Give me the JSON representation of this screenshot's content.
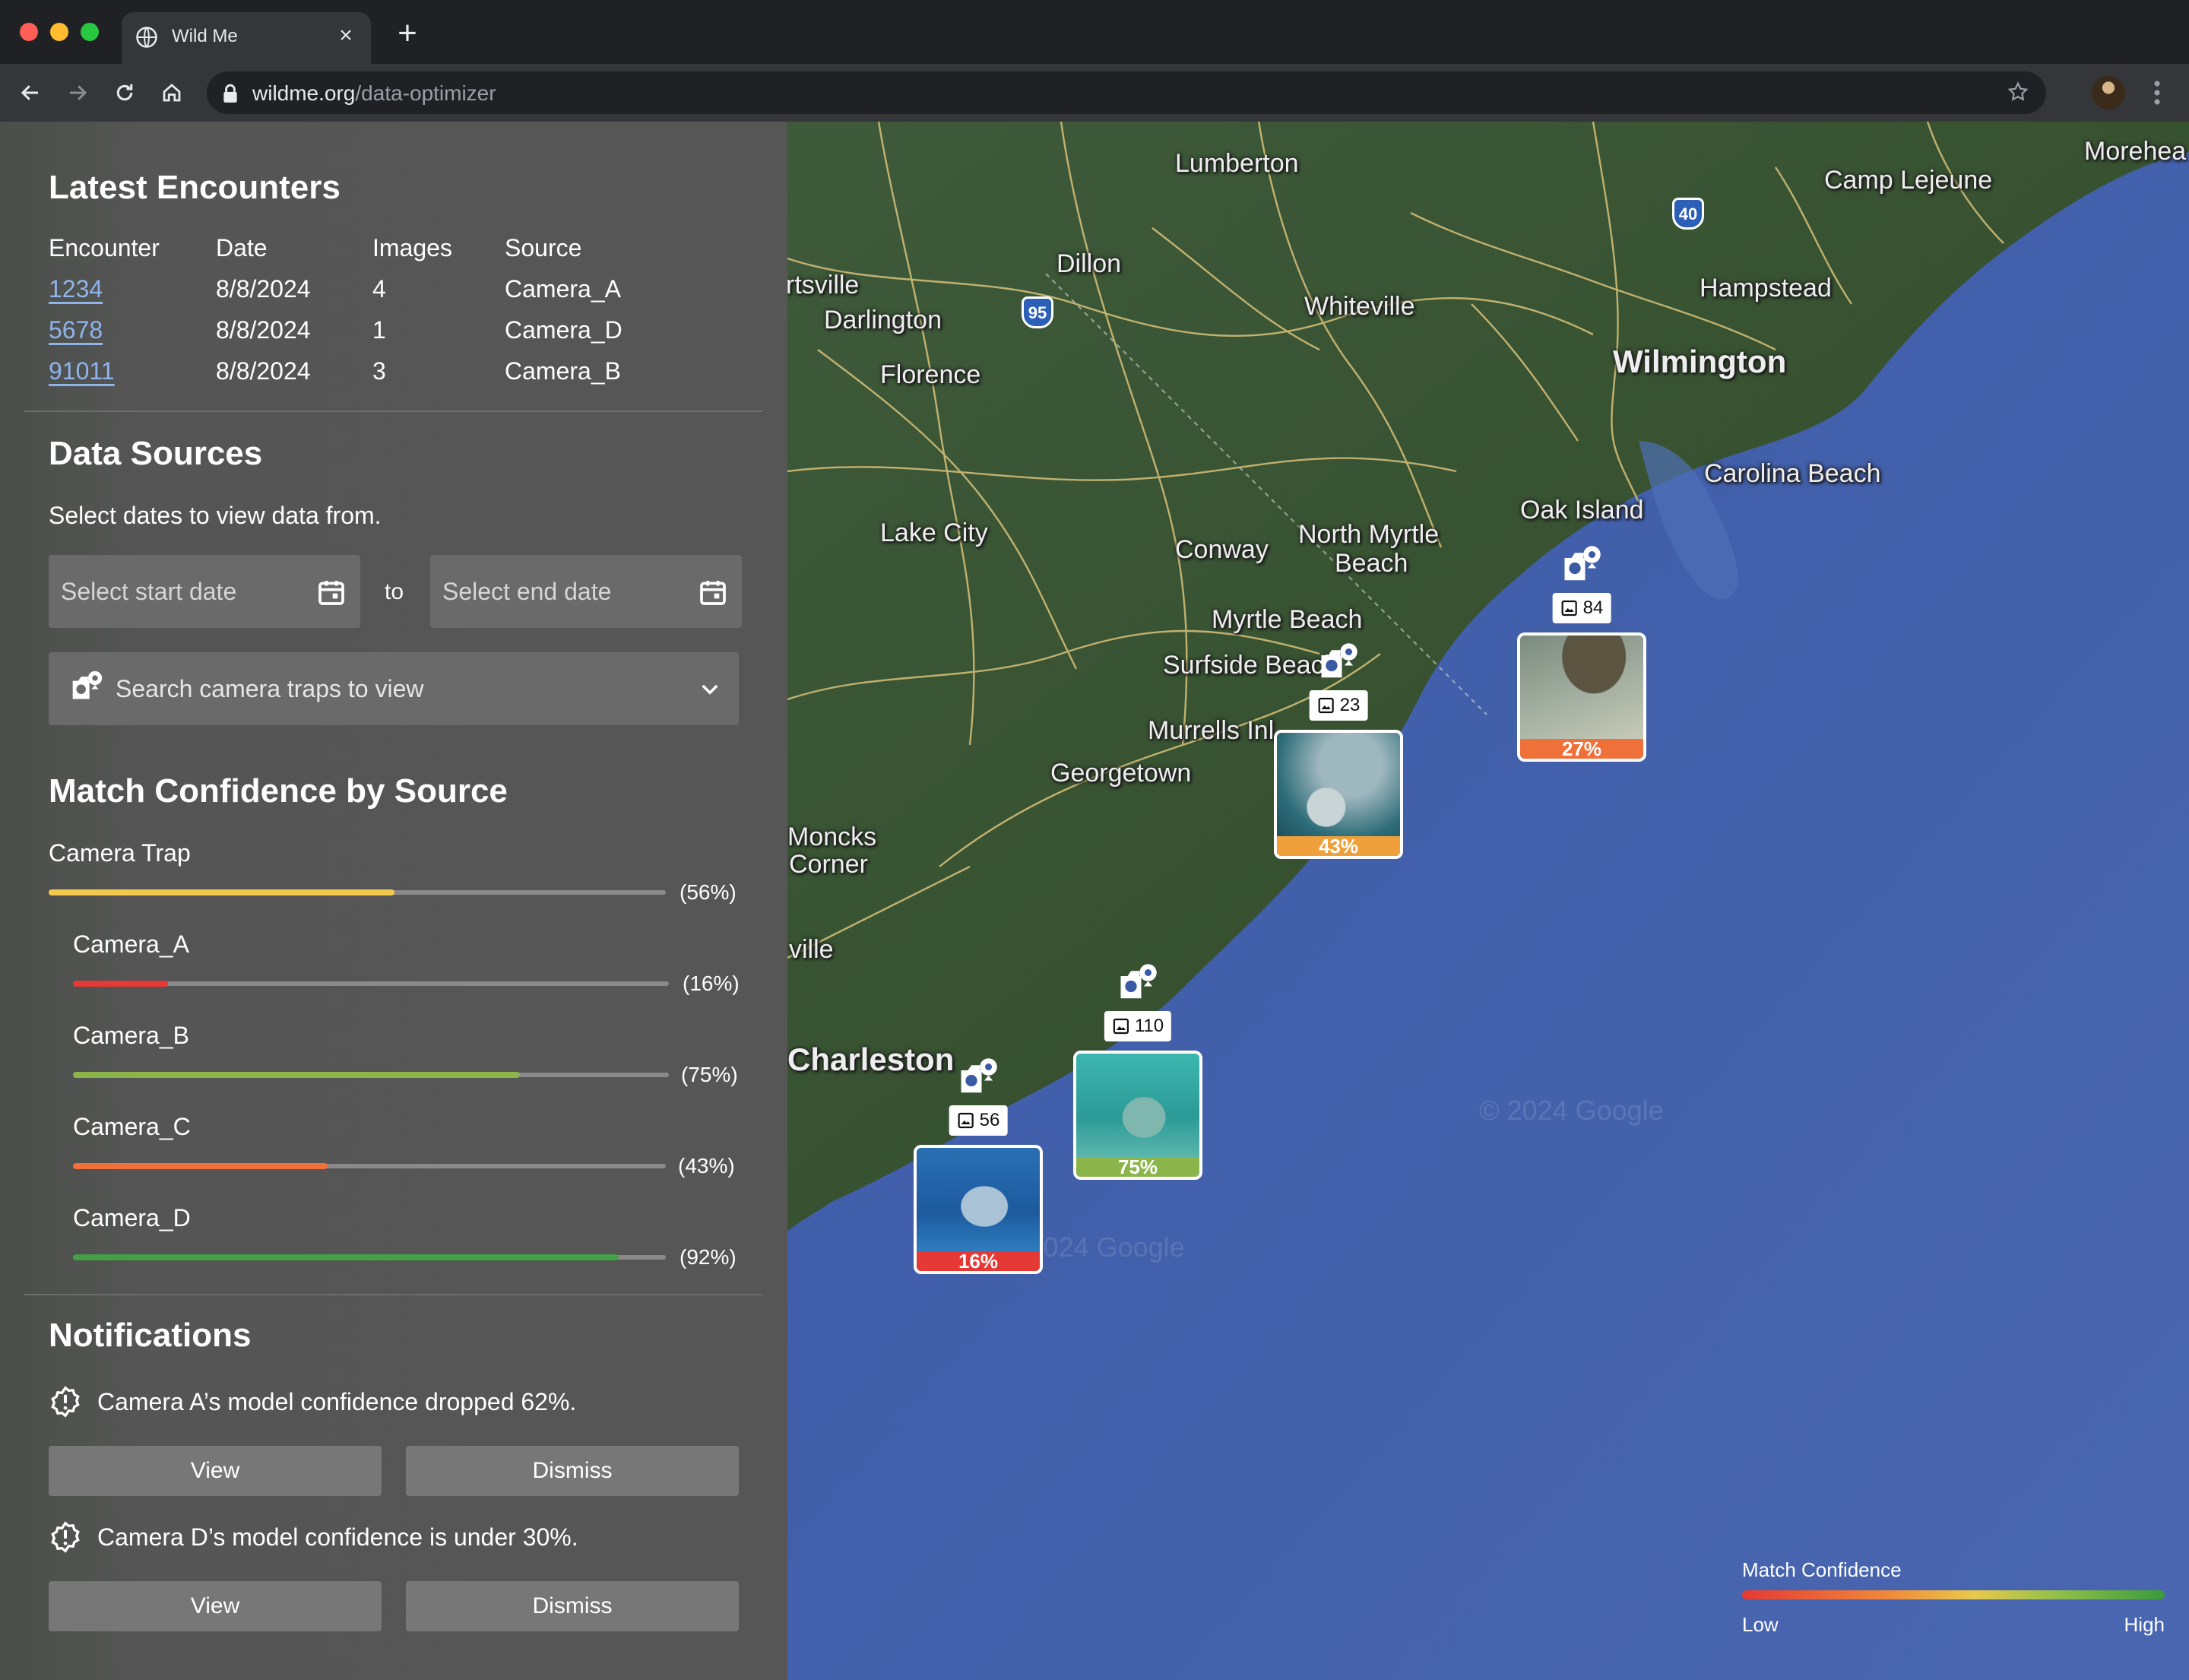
{
  "browser": {
    "tab_title": "Wild Me",
    "url_domain": "wildme.org",
    "url_path": "/data-optimizer",
    "traffic_colors": [
      "#ff5f57",
      "#febc2e",
      "#28c840"
    ]
  },
  "encounters": {
    "title": "Latest Encounters",
    "columns": [
      "Encounter",
      "Date",
      "Images",
      "Source"
    ],
    "rows": [
      {
        "id": "1234",
        "date": "8/8/2024",
        "images": "4",
        "source": "Camera_A"
      },
      {
        "id": "5678",
        "date": "8/8/2024",
        "images": "1",
        "source": "Camera_D"
      },
      {
        "id": "91011",
        "date": "8/8/2024",
        "images": "3",
        "source": "Camera_B"
      }
    ]
  },
  "data_sources": {
    "title": "Data Sources",
    "subtitle": "Select dates to view data from.",
    "start_placeholder": "Select start date",
    "to_label": "to",
    "end_placeholder": "Select end date",
    "search_placeholder": "Search camera traps to view"
  },
  "confidence": {
    "title": "Match Confidence by Source",
    "overall": {
      "label": "Camera Trap",
      "value": 56,
      "display": "(56%)",
      "color": "#f2c94c"
    },
    "cameras": [
      {
        "label": "Camera_A",
        "value": 16,
        "display": "(16%)",
        "color": "#e53935"
      },
      {
        "label": "Camera_B",
        "value": 75,
        "display": "(75%)",
        "color": "#8bb54a"
      },
      {
        "label": "Camera_C",
        "value": 43,
        "display": "(43%)",
        "color": "#f0703a"
      },
      {
        "label": "Camera_D",
        "value": 92,
        "display": "(92%)",
        "color": "#43a047"
      }
    ]
  },
  "notifications": {
    "title": "Notifications",
    "items": [
      {
        "text": "Camera A’s model confidence dropped 62%.",
        "view": "View",
        "dismiss": "Dismiss"
      },
      {
        "text": "Camera D’s model confidence is under 30%.",
        "view": "View",
        "dismiss": "Dismiss"
      }
    ]
  },
  "map": {
    "cities": [
      "Lumberton",
      "Morehea",
      "Camp Lejeune",
      "Dillon",
      "rtsville",
      "Darlington",
      "Whiteville",
      "Hampstead",
      "Wilmington",
      "Florence",
      "Carolina Beach",
      "Oak Island",
      "Lake City",
      "Conway",
      "North Myrtle",
      "Beach",
      "Myrtle Beach",
      "Surfside Beach",
      "Murrells Inl",
      "Georgetown",
      "Moncks",
      "Corner",
      "ville",
      "Charleston"
    ],
    "highways": [
      "95",
      "40"
    ],
    "markers": [
      {
        "count": "23",
        "confidence": "43%",
        "color": "#f0a03a"
      },
      {
        "count": "84",
        "confidence": "27%",
        "color": "#f0703a"
      },
      {
        "count": "110",
        "confidence": "75%",
        "color": "#8bb54a"
      },
      {
        "count": "56",
        "confidence": "16%",
        "color": "#e53935"
      }
    ],
    "legend": {
      "title": "Match Confidence",
      "low": "Low",
      "high": "High"
    },
    "watermark": "© 2024 Google"
  }
}
